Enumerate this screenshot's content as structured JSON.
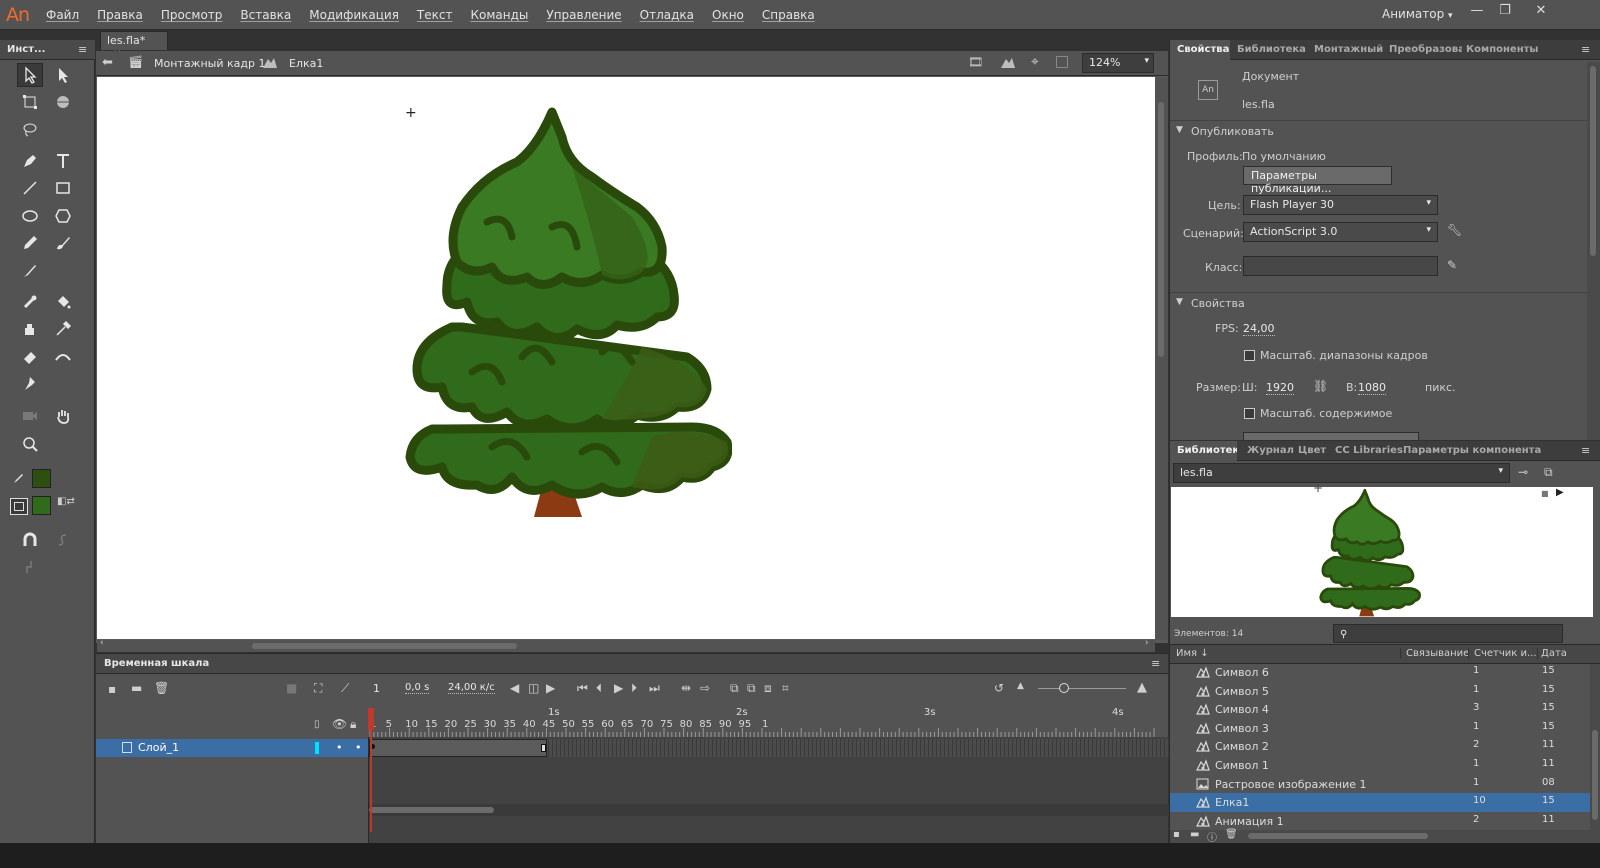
{
  "app": {
    "logo": "An",
    "workspace": "Аниматор"
  },
  "menu": [
    "Файл",
    "Правка",
    "Просмотр",
    "Вставка",
    "Модификация",
    "Текст",
    "Команды",
    "Управление",
    "Отладка",
    "Окно",
    "Справка"
  ],
  "tools_panel": {
    "title": "Инст..."
  },
  "document_tab": {
    "name": "les.fla*"
  },
  "editbar": {
    "scene": "Монтажный кадр 1",
    "symbol": "Елка1",
    "zoom": "124%"
  },
  "timeline": {
    "title": "Временная шкала",
    "current_frame": "1",
    "time": "0,0 s",
    "fps": "24,00 к/с",
    "layer_name": "Слой_1",
    "second_marks": [
      "1s",
      "2s",
      "3s",
      "4s"
    ],
    "frame_numbers": [
      "1",
      "5",
      "10",
      "15",
      "20",
      "25",
      "30",
      "35",
      "40",
      "45",
      "50",
      "55",
      "60",
      "65",
      "70",
      "75",
      "80",
      "85",
      "90",
      "95",
      "1"
    ]
  },
  "properties": {
    "tabs": [
      "Свойства",
      "Библиотека ки",
      "Монтажный к",
      "Преобразоват",
      "Компоненты"
    ],
    "doc_type": "Документ",
    "doc_name": "les.fla",
    "publish_section": "Опубликовать",
    "profile_label": "Профиль:",
    "profile_value": "По умолчанию",
    "publish_settings_button": "Параметры публикации...",
    "target_label": "Цель:",
    "target_value": "Flash Player 30",
    "script_label": "Сценарий:",
    "script_value": "ActionScript 3.0",
    "class_label": "Класс:",
    "props_section": "Свойства",
    "fps_label": "FPS:",
    "fps_value": "24,00",
    "scale_spans_label": "Масштаб. диапазоны кадров",
    "size_label": "Размер:",
    "width_label": "Ш:",
    "width_value": "1920",
    "height_label": "В:",
    "height_value": "1080",
    "units": "пикс.",
    "scale_content_label": "Масштаб. содержимое"
  },
  "library": {
    "tabs": [
      "Библиотека",
      "Журнал",
      "Цвет",
      "CC Libraries",
      "Параметры компонента"
    ],
    "document": "les.fla",
    "items_count": "Элементов: 14",
    "columns": [
      "Имя",
      "Связывание",
      "Счетчик и...",
      "Дата"
    ],
    "items": [
      {
        "name": "Символ 6",
        "count": "1",
        "date": "15",
        "icon": "symbol-icon"
      },
      {
        "name": "Символ 5",
        "count": "1",
        "date": "15",
        "icon": "symbol-icon"
      },
      {
        "name": "Символ 4",
        "count": "3",
        "date": "15",
        "icon": "symbol-icon"
      },
      {
        "name": "Символ 3",
        "count": "1",
        "date": "15",
        "icon": "symbol-icon"
      },
      {
        "name": "Символ 2",
        "count": "2",
        "date": "11",
        "icon": "symbol-icon"
      },
      {
        "name": "Символ 1",
        "count": "1",
        "date": "11",
        "icon": "symbol-icon"
      },
      {
        "name": "Растровое изображение 1",
        "count": "1",
        "date": "08",
        "icon": "bitmap-icon"
      },
      {
        "name": "Елка1",
        "count": "10",
        "date": "15",
        "icon": "symbol-icon"
      },
      {
        "name": "Анимация 1",
        "count": "2",
        "date": "11",
        "icon": "symbol-icon"
      }
    ],
    "selected_index": 7
  },
  "colors": {
    "stroke": "#2f4f10",
    "fill": "#2f6b1a",
    "accent": "#3b6ea5",
    "playhead": "#c0392b"
  }
}
